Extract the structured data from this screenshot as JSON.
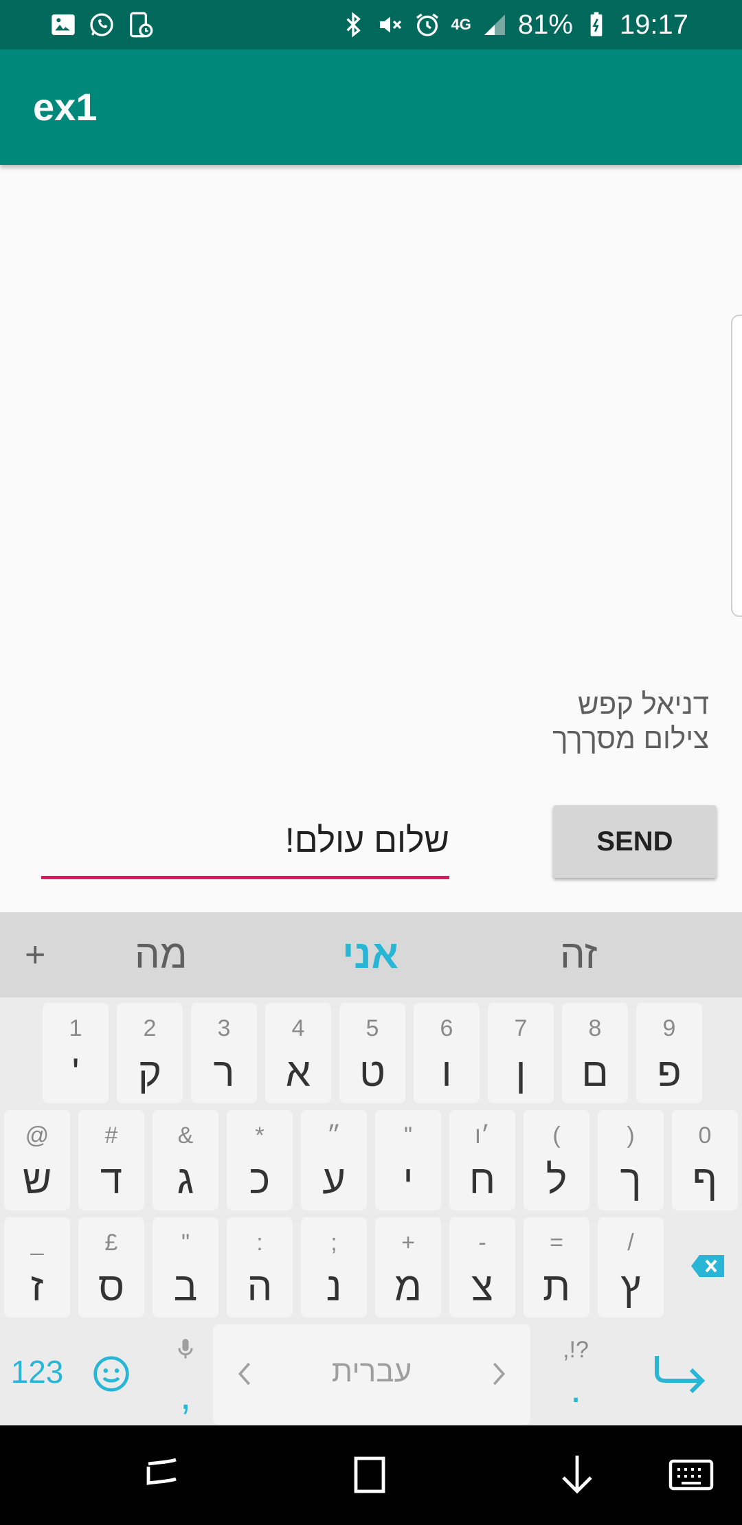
{
  "status_bar": {
    "battery": "81%",
    "time": "19:17",
    "network": "4G",
    "left_icons": [
      "image-icon",
      "whatsapp-icon",
      "device-schedule-icon"
    ],
    "right_icons": [
      "bluetooth-icon",
      "mute-icon",
      "alarm-icon",
      "network-4g-icon",
      "signal-icon",
      "battery-charging-icon"
    ]
  },
  "app_bar": {
    "title": "ex1"
  },
  "content": {
    "info_line1": "דניאל קפש",
    "info_line2": "צילום מסךךך",
    "message_value": "שלום עולם!",
    "send_label": "SEND"
  },
  "keyboard": {
    "suggestions": [
      "מה",
      "אני",
      "זה"
    ],
    "suggestion_plus": "+",
    "row1": [
      {
        "sec": "1",
        "main": "'"
      },
      {
        "sec": "2",
        "main": "ק"
      },
      {
        "sec": "3",
        "main": "ר"
      },
      {
        "sec": "4",
        "main": "א"
      },
      {
        "sec": "5",
        "main": "ט"
      },
      {
        "sec": "6",
        "main": "ו"
      },
      {
        "sec": "7",
        "main": "ן"
      },
      {
        "sec": "8",
        "main": "ם"
      },
      {
        "sec": "9",
        "main": "פ"
      }
    ],
    "row2": [
      {
        "sec": "@",
        "main": "ש"
      },
      {
        "sec": "#",
        "main": "ד"
      },
      {
        "sec": "&",
        "main": "ג"
      },
      {
        "sec": "*",
        "main": "כ"
      },
      {
        "sec": "״",
        "main": "ע"
      },
      {
        "sec": "\"",
        "main": "י"
      },
      {
        "sec": "׳ו",
        "main": "ח"
      },
      {
        "sec": "(",
        "main": "ל"
      },
      {
        "sec": ")",
        "main": "ך"
      },
      {
        "sec": "0",
        "main": "ף"
      }
    ],
    "row3": [
      {
        "sec": "_",
        "main": "ז"
      },
      {
        "sec": "£",
        "main": "ס"
      },
      {
        "sec": "\"",
        "main": "ב"
      },
      {
        "sec": ":",
        "main": "ה"
      },
      {
        "sec": ";",
        "main": "נ"
      },
      {
        "sec": "+",
        "main": "מ"
      },
      {
        "sec": "-",
        "main": "צ"
      },
      {
        "sec": "=",
        "main": "ת"
      },
      {
        "sec": "/",
        "main": "ץ"
      }
    ],
    "numbers_label": "123",
    "space_label": "עברית",
    "comma": ",",
    "period": ".",
    "period_sec": ",!?",
    "accent_color": "#29b6d6"
  },
  "colors": {
    "status_bar": "#00695c",
    "app_bar": "#00897b",
    "input_underline": "#d81b60"
  },
  "nav_bar": {
    "icons": [
      "recent-apps-icon",
      "home-icon",
      "back-icon",
      "keyboard-icon"
    ]
  }
}
